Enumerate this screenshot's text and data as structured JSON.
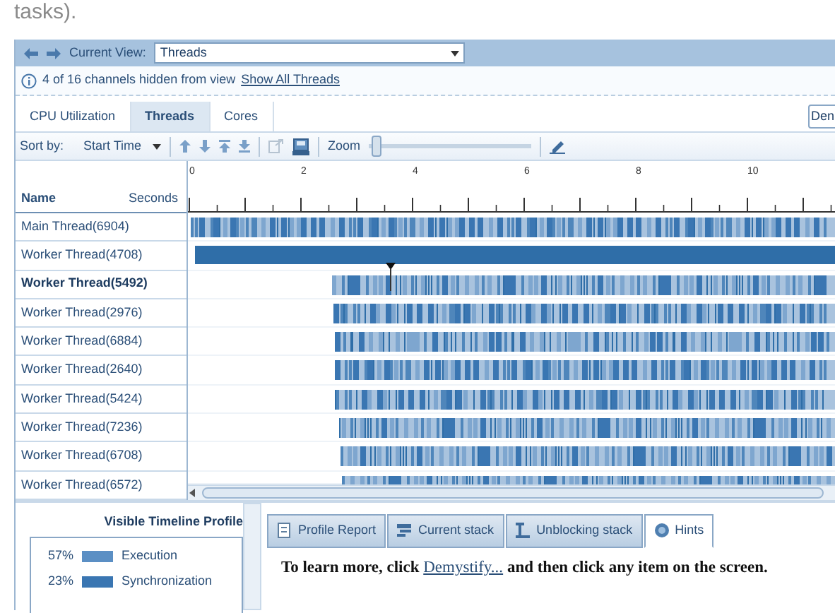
{
  "top_text": "tasks).",
  "nav": {
    "label": "Current View:",
    "view": "Threads"
  },
  "notice": {
    "text": "4 of 16  channels hidden from view",
    "link": "Show All Threads"
  },
  "tabs": [
    {
      "label": "CPU Utilization",
      "selected": false
    },
    {
      "label": "Threads",
      "selected": true
    },
    {
      "label": "Cores",
      "selected": false
    }
  ],
  "right_field": "Den",
  "toolbar": {
    "sort_label": "Sort by:",
    "sort_value": "Start Time",
    "zoom_label": "Zoom",
    "zoom": {
      "level": 0.02
    }
  },
  "columns": {
    "name": "Name",
    "seconds": "Seconds"
  },
  "ruler": [
    "0",
    "2",
    "4",
    "6",
    "8",
    "10"
  ],
  "threads": [
    {
      "name": "Main Thread(6904)",
      "kind": "stripes",
      "selected": false
    },
    {
      "name": "Worker Thread(4708)",
      "kind": "solid",
      "selected": false
    },
    {
      "name": "Worker Thread(5492)",
      "kind": "stripes",
      "selected": true
    },
    {
      "name": "Worker Thread(2976)",
      "kind": "stripes",
      "selected": false
    },
    {
      "name": "Worker Thread(6884)",
      "kind": "stripes",
      "selected": false
    },
    {
      "name": "Worker Thread(2640)",
      "kind": "stripes",
      "selected": false
    },
    {
      "name": "Worker Thread(5424)",
      "kind": "stripes",
      "selected": false
    },
    {
      "name": "Worker Thread(7236)",
      "kind": "stripes",
      "selected": false
    },
    {
      "name": "Worker Thread(6708)",
      "kind": "stripes",
      "selected": false
    },
    {
      "name": "Worker Thread(6572)",
      "kind": "stripes",
      "selected": false
    }
  ],
  "profile": {
    "title": "Visible Timeline Profile",
    "items": [
      {
        "percent": "57%",
        "label": "Execution",
        "color": "#5b8fc4"
      },
      {
        "percent": "23%",
        "label": "Synchronization",
        "color": "#3a76b2"
      }
    ]
  },
  "bottom_tabs": [
    {
      "label": "Profile Report",
      "selected": false
    },
    {
      "label": "Current stack",
      "selected": false
    },
    {
      "label": "Unblocking stack",
      "selected": false
    },
    {
      "label": "Hints",
      "selected": true
    }
  ],
  "hint": {
    "before": "To learn more, click ",
    "link": "Demystify...",
    "after": " and then click any item on the screen."
  }
}
